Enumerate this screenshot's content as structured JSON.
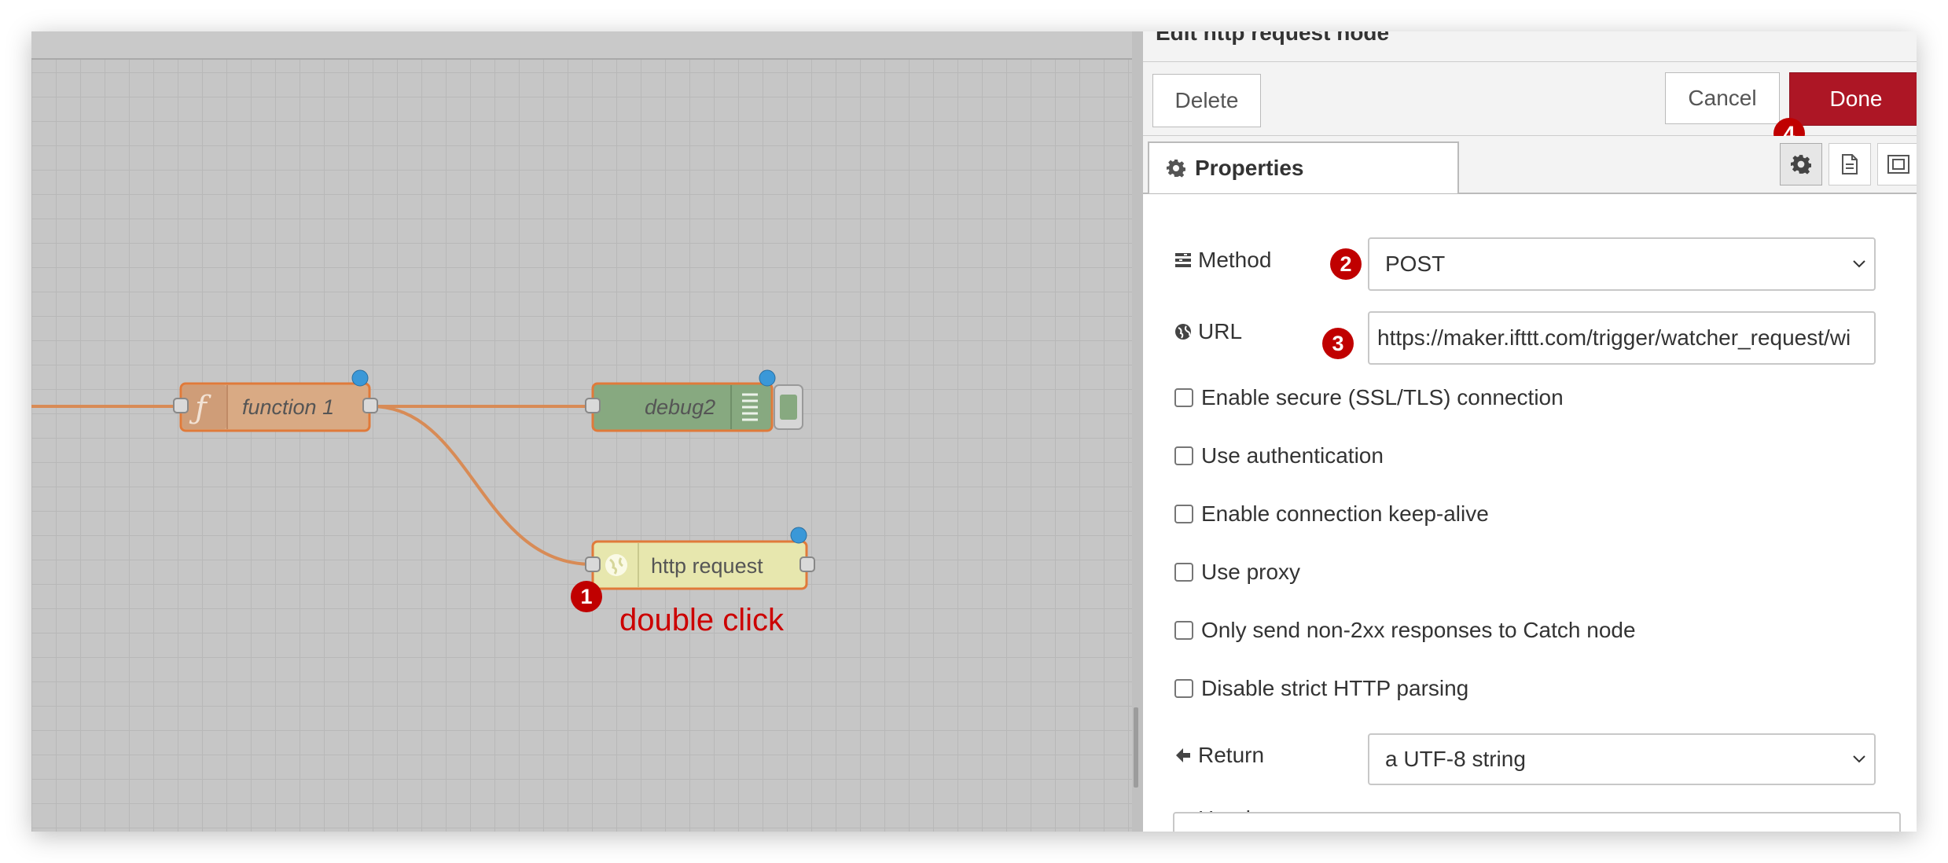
{
  "workspace": {
    "nodes": {
      "function1": {
        "label": "function 1",
        "icon": "function-icon",
        "color": "#d9aa84"
      },
      "debug2": {
        "label": "debug2",
        "icon": "debug-list-icon",
        "color": "#87a980"
      },
      "http_request": {
        "label": "http request",
        "icon": "globe-icon",
        "color": "#e7e7ae"
      }
    },
    "wire_color": "#d88b56",
    "annotation": {
      "text": "double click",
      "color": "#cc0000"
    }
  },
  "badges": [
    "1",
    "2",
    "3",
    "4"
  ],
  "tray": {
    "title": "Edit http request node",
    "delete_label": "Delete",
    "cancel_label": "Cancel",
    "done_label": "Done",
    "done_color": "#ad1625",
    "tab_properties_label": "Properties",
    "tab_icons": [
      "gear-icon",
      "description-icon",
      "appearance-icon"
    ]
  },
  "form": {
    "method": {
      "label": "Method",
      "value": "POST",
      "icon": "method-icon"
    },
    "url": {
      "label": "URL",
      "value": "https://maker.ifttt.com/trigger/watcher_request/wi",
      "icon": "globe-icon"
    },
    "checkboxes": [
      {
        "label": "Enable secure (SSL/TLS) connection",
        "checked": false
      },
      {
        "label": "Use authentication",
        "checked": false
      },
      {
        "label": "Enable connection keep-alive",
        "checked": false
      },
      {
        "label": "Use proxy",
        "checked": false
      },
      {
        "label": "Only send non-2xx responses to Catch node",
        "checked": false
      },
      {
        "label": "Disable strict HTTP parsing",
        "checked": false
      }
    ],
    "return": {
      "label": "Return",
      "value": "a UTF-8 string",
      "icon": "arrow-left-icon"
    },
    "headers": {
      "label": "Headers",
      "icon": "list-icon"
    }
  }
}
